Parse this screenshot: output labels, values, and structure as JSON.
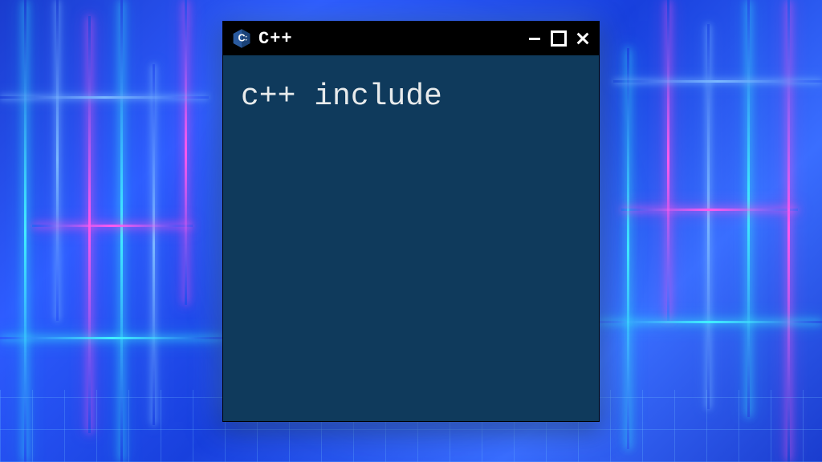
{
  "window": {
    "title": "C++",
    "icon_name": "cpp-logo-icon"
  },
  "editor": {
    "content": "c++ include"
  },
  "colors": {
    "titlebar_bg": "#000000",
    "body_bg": "#0f3a5c",
    "text": "#e8ebec"
  }
}
